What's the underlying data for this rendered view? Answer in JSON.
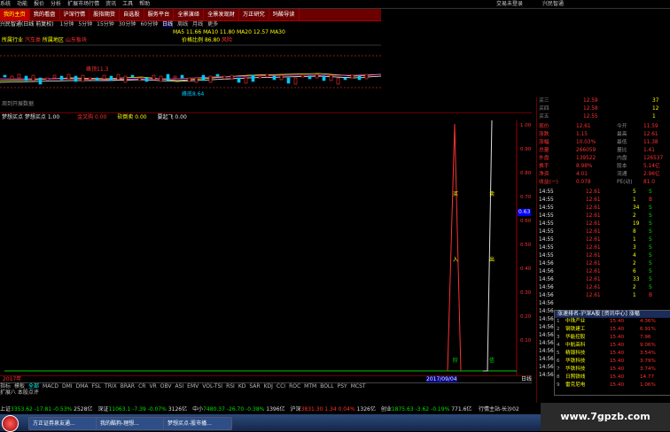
{
  "menu": {
    "items": [
      "系统",
      "功能",
      "报价",
      "分析",
      "扩展市场行情",
      "资讯",
      "工具",
      "帮助"
    ],
    "right_items": [
      "交易未登录",
      "兴民智通"
    ]
  },
  "nav": {
    "tabs": [
      "我的主页",
      "我的看盘",
      "沪深行情",
      "股指期货",
      "自选股",
      "服务平台",
      "全景演绎",
      "全景发现财",
      "万正研究",
      "玛酸导读"
    ],
    "active": "我的主页"
  },
  "toolbar": {
    "label": "兴民智通(日线 前复权)",
    "timeframes": [
      "1分钟",
      "5分钟",
      "15分钟",
      "30分钟",
      "60分钟",
      "日线",
      "周线",
      "月线",
      "更多"
    ],
    "selected": "日线"
  },
  "price_chart": {
    "ma_line": "MA5 11.66 MA10 11.80 MA20 12.57 MA30",
    "labels": [
      "所属行业",
      "汽车类",
      "所属地区",
      "山东板块"
    ],
    "overlay_labels": [
      "价格比例",
      "86.80",
      "风险"
    ],
    "annotations": [
      "峰顶11.3",
      "峰底8.64"
    ],
    "footer": "周到开展数据"
  },
  "indicator": {
    "title": "梦想买点 梦想买点 1.00",
    "labels": [
      "金叉购 0.00",
      "砍倒卖 0.00",
      "要起飞 0.00"
    ],
    "ticks": [
      "1.00",
      "0.90",
      "0.80",
      "0.70",
      "0.60",
      "0.50",
      "0.40",
      "0.30",
      "0.20",
      "0.10"
    ],
    "cursor_value": "0.63",
    "date_marker": "2017/09/04",
    "year_label": "2017年",
    "vertical_labels": [
      "买",
      "入",
      "阶",
      "段",
      "卖",
      "出",
      "信",
      "号"
    ]
  },
  "bottom_tabs": [
    "指标",
    "模板",
    "全部",
    "MACD",
    "DMI",
    "DMA",
    "FSL",
    "TRIX",
    "BRAR",
    "CR",
    "VR",
    "OBV",
    "ASI",
    "EMV",
    "VOL-TSI",
    "RSI",
    "KD",
    "SAR",
    "KDJ",
    "CCI",
    "ROC",
    "MTM",
    "BOLL",
    "PSY",
    "MCST"
  ],
  "bottom_tabs2": "扩展八 本股点评",
  "quote": {
    "sell_levels": [
      {
        "label": "买三",
        "price": "12.59",
        "vol": "37"
      },
      {
        "label": "买四",
        "price": "12.58",
        "vol": "12"
      },
      {
        "label": "买五",
        "price": "12.55",
        "vol": "1"
      }
    ],
    "stats": [
      {
        "k1": "现价",
        "v1": "12.61",
        "k2": "今开",
        "v2": "11.59"
      },
      {
        "k1": "涨跌",
        "v1": "1.15",
        "k2": "最高",
        "v2": "12.61"
      },
      {
        "k1": "涨幅",
        "v1": "10.03%",
        "k2": "最低",
        "v2": "11.38"
      },
      {
        "k1": "总量",
        "v1": "266059",
        "k2": "量比",
        "v2": "1.41"
      },
      {
        "k1": "外盘",
        "v1": "139522",
        "k2": "内盘",
        "v2": "126537"
      },
      {
        "k1": "换手",
        "v1": "8.98%",
        "k2": "股本",
        "v2": "5.14亿"
      },
      {
        "k1": "净资",
        "v1": "4.01",
        "k2": "流通",
        "v2": "2.96亿"
      },
      {
        "k1": "收益(一)",
        "v1": "0.078",
        "k2": "PE(动)",
        "v2": "81.0"
      }
    ],
    "ticks": [
      {
        "t": "14:55",
        "p": "12.61",
        "v": "5",
        "d": "S"
      },
      {
        "t": "14:55",
        "p": "12.61",
        "v": "1",
        "d": "B"
      },
      {
        "t": "14:55",
        "p": "12.61",
        "v": "34",
        "d": "S"
      },
      {
        "t": "14:55",
        "p": "12.61",
        "v": "2",
        "d": "S"
      },
      {
        "t": "14:55",
        "p": "12.61",
        "v": "19",
        "d": "S"
      },
      {
        "t": "14:55",
        "p": "12.61",
        "v": "8",
        "d": "S"
      },
      {
        "t": "14:55",
        "p": "12.61",
        "v": "1",
        "d": "S"
      },
      {
        "t": "14:55",
        "p": "12.61",
        "v": "3",
        "d": "S"
      },
      {
        "t": "14:55",
        "p": "12.61",
        "v": "4",
        "d": "S"
      },
      {
        "t": "14:56",
        "p": "12.61",
        "v": "2",
        "d": "S"
      },
      {
        "t": "14:56",
        "p": "12.61",
        "v": "6",
        "d": "S"
      },
      {
        "t": "14:56",
        "p": "12.61",
        "v": "33",
        "d": "S"
      },
      {
        "t": "14:56",
        "p": "12.61",
        "v": "2",
        "d": "S"
      },
      {
        "t": "14:56",
        "p": "12.61",
        "v": "1",
        "d": "B"
      }
    ],
    "tick_times_lower": [
      "14:56",
      "14:56",
      "14:56",
      "14:56",
      "14:56",
      "14:56",
      "14:56",
      "14:56",
      "14:56",
      "14:56"
    ]
  },
  "popup": {
    "title": "涨速排名-沪深A股 [资讯中心] 涨幅",
    "rows": [
      {
        "n": "中珠产业",
        "p": "15.40",
        "c": "4.36%"
      },
      {
        "n": "钢铁建工",
        "p": "15.40",
        "c": "6.91%"
      },
      {
        "n": "华能控股",
        "p": "15.40",
        "c": "7.96"
      },
      {
        "n": "中航高科",
        "p": "15.40",
        "c": "9.06%"
      },
      {
        "n": "精锻科技",
        "p": "15.40",
        "c": "3.54%"
      },
      {
        "n": "华铁科技",
        "p": "15.40",
        "c": "3.79%"
      },
      {
        "n": "华铁科技",
        "p": "15.40",
        "c": "3.74%"
      },
      {
        "n": "日照铁线",
        "p": "15.40",
        "c": "14.77"
      },
      {
        "n": "雷克尼电",
        "p": "15.40",
        "c": "1.06%"
      }
    ]
  },
  "status_bar": {
    "items": [
      {
        "k": "上证",
        "v": "3353.62",
        "c": "-17.81",
        "p": "-0.53%",
        "a": "2528亿"
      },
      {
        "k": "深证",
        "v": "11063.1",
        "c": "-7.39",
        "p": "-0.07%",
        "a": "3126亿"
      },
      {
        "k": "中小",
        "v": "7480.37",
        "c": "-26.70",
        "p": "-0.38%",
        "a": "1396亿"
      },
      {
        "k": "沪深",
        "v": "3831.30",
        "c": "1.34",
        "p": "0.04%",
        "a": "1326亿"
      },
      {
        "k": "创业",
        "v": "1875.63",
        "c": "-3.62",
        "p": "-0.19%",
        "a": "771.6亿"
      }
    ],
    "right": "行情主站-长沙02"
  },
  "taskbar": {
    "items": [
      "方正证券泉友通...",
      "我的酷狗-理想...",
      "梦想买点-股市播..."
    ]
  },
  "watermark": "www.7gpzb.com",
  "colors": {
    "up": "#ff3030",
    "down": "#00e000",
    "accent": "#ffff00",
    "nav_bg": "#6a0000"
  }
}
